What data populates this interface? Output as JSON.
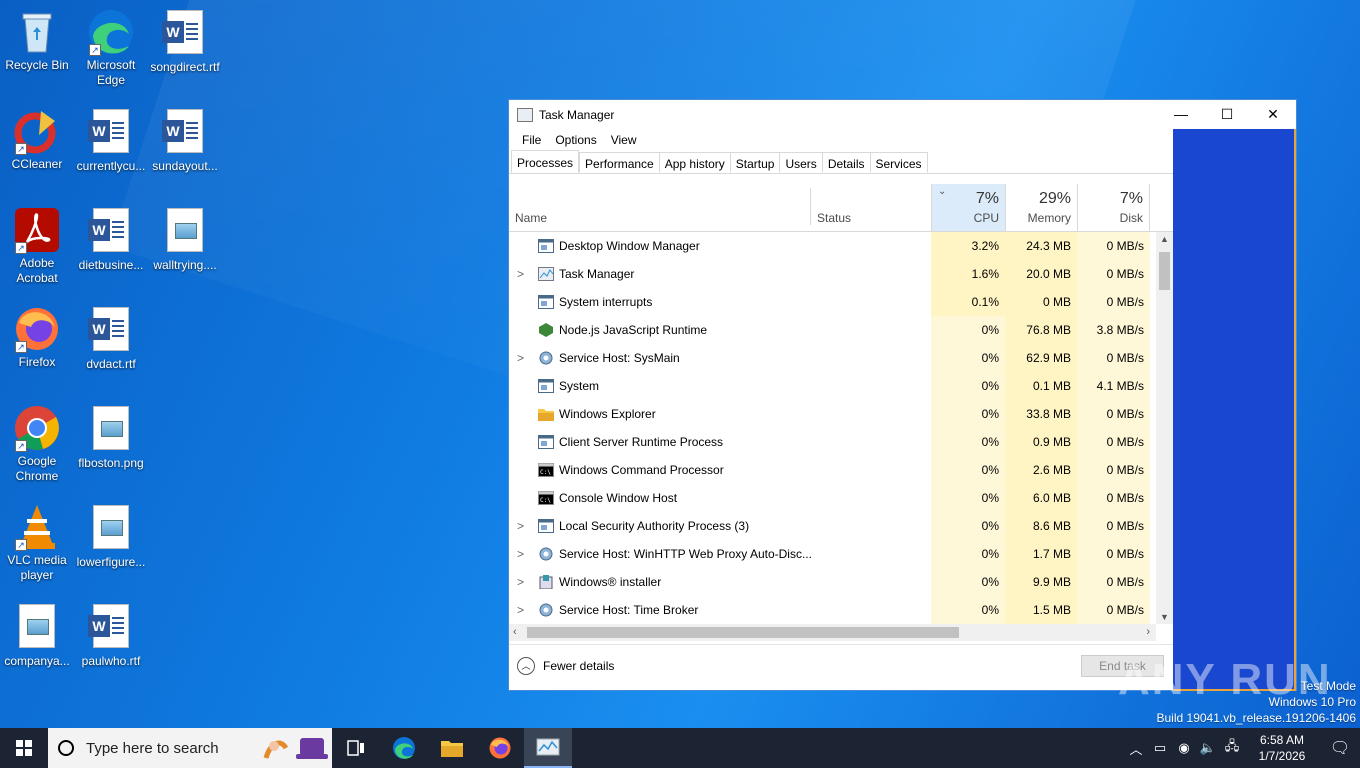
{
  "desktop": {
    "icons": [
      {
        "label": "Recycle Bin"
      },
      {
        "label": "Microsoft Edge"
      },
      {
        "label": "songdirect.rtf"
      },
      {
        "label": "CCleaner"
      },
      {
        "label": "currentlycu..."
      },
      {
        "label": "sundayout..."
      },
      {
        "label": "Adobe Acrobat"
      },
      {
        "label": "dietbusine..."
      },
      {
        "label": "walltrying...."
      },
      {
        "label": "Firefox"
      },
      {
        "label": "dvdact.rtf"
      },
      {
        "label": "Google Chrome"
      },
      {
        "label": "flboston.png"
      },
      {
        "label": "VLC media player"
      },
      {
        "label": "lowerfigure..."
      },
      {
        "label": "companya..."
      },
      {
        "label": "paulwho.rtf"
      }
    ]
  },
  "taskmanager": {
    "title": "Task Manager",
    "window_buttons": {
      "minimize": "—",
      "maximize": "☐",
      "close": "✕"
    },
    "menu": [
      "File",
      "Options",
      "View"
    ],
    "tabs": [
      "Processes",
      "Performance",
      "App history",
      "Startup",
      "Users",
      "Details",
      "Services"
    ],
    "active_tab": "Processes",
    "columns": {
      "name": "Name",
      "status": "Status",
      "cpu": {
        "pct": "7%",
        "label": "CPU"
      },
      "memory": {
        "pct": "29%",
        "label": "Memory"
      },
      "disk": {
        "pct": "7%",
        "label": "Disk"
      }
    },
    "processes": [
      {
        "name": "Desktop Window Manager",
        "expand": "",
        "cpu": "3.2%",
        "mem": "24.3 MB",
        "disk": "0 MB/s"
      },
      {
        "name": "Task Manager",
        "expand": ">",
        "cpu": "1.6%",
        "mem": "20.0 MB",
        "disk": "0 MB/s"
      },
      {
        "name": "System interrupts",
        "expand": "",
        "cpu": "0.1%",
        "mem": "0 MB",
        "disk": "0 MB/s"
      },
      {
        "name": "Node.js JavaScript Runtime",
        "expand": "",
        "cpu": "0%",
        "mem": "76.8 MB",
        "disk": "3.8 MB/s"
      },
      {
        "name": "Service Host: SysMain",
        "expand": ">",
        "cpu": "0%",
        "mem": "62.9 MB",
        "disk": "0 MB/s"
      },
      {
        "name": "System",
        "expand": "",
        "cpu": "0%",
        "mem": "0.1 MB",
        "disk": "4.1 MB/s"
      },
      {
        "name": "Windows Explorer",
        "expand": "",
        "cpu": "0%",
        "mem": "33.8 MB",
        "disk": "0 MB/s"
      },
      {
        "name": "Client Server Runtime Process",
        "expand": "",
        "cpu": "0%",
        "mem": "0.9 MB",
        "disk": "0 MB/s"
      },
      {
        "name": "Windows Command Processor",
        "expand": "",
        "cpu": "0%",
        "mem": "2.6 MB",
        "disk": "0 MB/s"
      },
      {
        "name": "Console Window Host",
        "expand": "",
        "cpu": "0%",
        "mem": "6.0 MB",
        "disk": "0 MB/s"
      },
      {
        "name": "Local Security Authority Process (3)",
        "expand": ">",
        "cpu": "0%",
        "mem": "8.6 MB",
        "disk": "0 MB/s"
      },
      {
        "name": "Service Host: WinHTTP Web Proxy Auto-Disc...",
        "expand": ">",
        "cpu": "0%",
        "mem": "1.7 MB",
        "disk": "0 MB/s"
      },
      {
        "name": "Windows® installer",
        "expand": ">",
        "cpu": "0%",
        "mem": "9.9 MB",
        "disk": "0 MB/s"
      },
      {
        "name": "Service Host: Time Broker",
        "expand": ">",
        "cpu": "0%",
        "mem": "1.5 MB",
        "disk": "0 MB/s"
      }
    ],
    "fewer_details": "Fewer details",
    "end_task": "End task"
  },
  "watermark": {
    "test_mode": "Test Mode",
    "edition": "Windows 10 Pro",
    "build": "Build 19041.vb_release.191206-1406",
    "anyrun": "ANY RUN"
  },
  "taskbar": {
    "search_placeholder": "Type here to search",
    "time": "6:58 AM",
    "date": "1/7/2026"
  },
  "colors": {
    "cpu_high": "#fff4c4",
    "cpu_low": "#fff8d8",
    "accent_blue": "#1947cf",
    "orange_border": "#e8a33a"
  }
}
